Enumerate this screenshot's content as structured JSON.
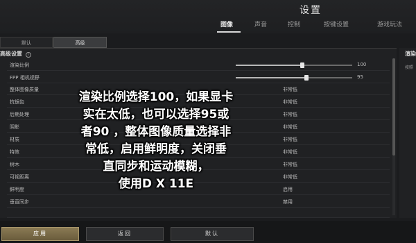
{
  "header": {
    "title": "设置",
    "tabs": [
      {
        "label": "图像",
        "active": true
      },
      {
        "label": "声音",
        "active": false
      },
      {
        "label": "控制",
        "active": false
      },
      {
        "label": "按键设置",
        "active": false
      },
      {
        "label": "游戏玩法",
        "active": false
      }
    ]
  },
  "subtabs": [
    {
      "label": "默认",
      "active": false
    },
    {
      "label": "高级",
      "active": true
    }
  ],
  "section": {
    "title": "高级设置",
    "info_icon": "i"
  },
  "settings": [
    {
      "label": "渲染比例",
      "type": "slider",
      "value": "100",
      "fraction": 0.57
    },
    {
      "label": "FPP 相机视野",
      "type": "slider",
      "value": "95",
      "fraction": 0.61
    },
    {
      "label": "整体图像质量",
      "type": "select",
      "value": "非常低"
    },
    {
      "label": "抗锯齿",
      "type": "select",
      "value": "非常低"
    },
    {
      "label": "后期处理",
      "type": "select",
      "value": "非常低"
    },
    {
      "label": "阴影",
      "type": "select",
      "value": "非常低"
    },
    {
      "label": "材质",
      "type": "select",
      "value": "非常低"
    },
    {
      "label": "特效",
      "type": "select",
      "value": "非常低"
    },
    {
      "label": "树木",
      "type": "select",
      "value": "非常低"
    },
    {
      "label": "可视距离",
      "type": "select",
      "value": "非常低"
    },
    {
      "label": "鲜明度",
      "type": "select",
      "value": "启用"
    },
    {
      "label": "垂直同步",
      "type": "select",
      "value": "禁用"
    },
    {
      "label": "",
      "type": "select",
      "value": ""
    }
  ],
  "right_panel": {
    "title": "渲染",
    "desc": "按照"
  },
  "overlay_text": [
    "渲染比例选择100，如果显卡",
    "实在太低，也可以选择95或",
    "者90 ，整体图像质量选择非",
    "常低，启用鲜明度，关闭垂",
    "直同步和运动模糊，",
    "使用D X 11E"
  ],
  "buttons": {
    "apply": "应用",
    "back": "返回",
    "default": "默认"
  },
  "colors": {
    "background": "#1b1c1e",
    "accent_gold": "#8a7a54",
    "text": "#c9c9c9"
  }
}
